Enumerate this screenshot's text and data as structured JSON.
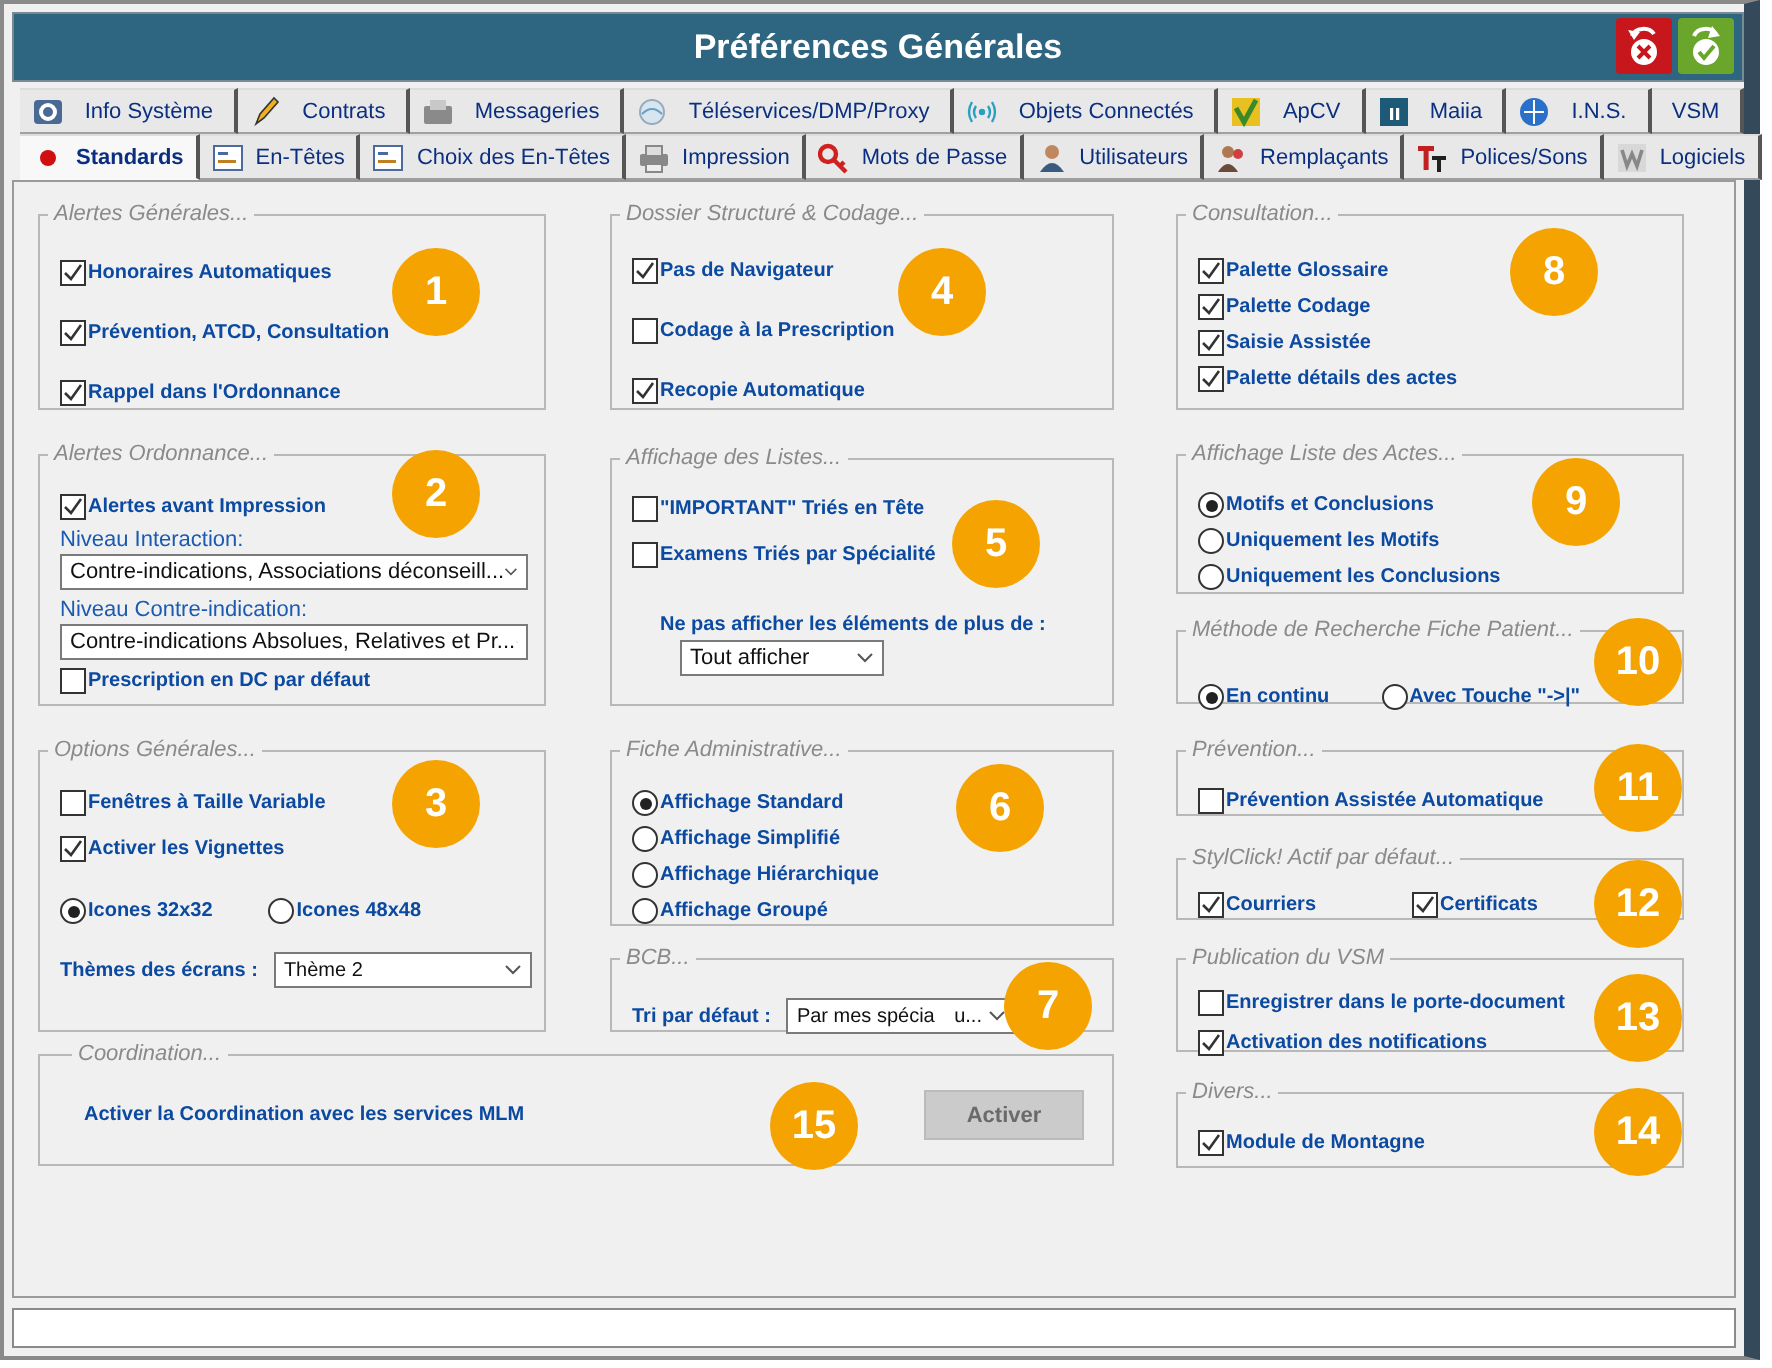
{
  "window": {
    "title": "Préférences Générales"
  },
  "tab_rows": [
    [
      {
        "label": "Info Système",
        "selected": false
      },
      {
        "label": "Contrats",
        "selected": false
      },
      {
        "label": "Messageries",
        "selected": false
      },
      {
        "label": "Téléservices/DMP/Proxy",
        "selected": false
      },
      {
        "label": "Objets Connectés",
        "selected": false
      },
      {
        "label": "ApCV",
        "selected": false
      },
      {
        "label": "Maiia",
        "selected": false
      },
      {
        "label": "I.N.S.",
        "selected": false
      },
      {
        "label": "VSM",
        "selected": false
      }
    ],
    [
      {
        "label": "Standards",
        "selected": true
      },
      {
        "label": "En-Têtes",
        "selected": false
      },
      {
        "label": "Choix des En-Têtes",
        "selected": false
      },
      {
        "label": "Impression",
        "selected": false
      },
      {
        "label": "Mots de Passe",
        "selected": false
      },
      {
        "label": "Utilisateurs",
        "selected": false
      },
      {
        "label": "Remplaçants",
        "selected": false
      },
      {
        "label": "Polices/Sons",
        "selected": false
      },
      {
        "label": "Logiciels",
        "selected": false
      }
    ]
  ],
  "columns": [
    [
      {
        "legend": "Alertes Générales...",
        "badge": "1",
        "items": [
          {
            "kind": "checkbox",
            "label": "Honoraires Automatiques",
            "checked": true
          },
          {
            "kind": "checkbox",
            "label": "Prévention, ATCD, Consultation",
            "checked": true
          },
          {
            "kind": "checkbox",
            "label": "Rappel dans l'Ordonnance",
            "checked": true
          }
        ]
      },
      {
        "legend": "Alertes Ordonnance...",
        "badge": "2",
        "items": [
          {
            "kind": "checkbox",
            "label": "Alertes avant Impression",
            "checked": true
          },
          {
            "kind": "caption",
            "text": "Niveau Interaction:"
          },
          {
            "kind": "select",
            "value": "Contre-indications, Associations déconseill..."
          },
          {
            "kind": "caption",
            "text": "Niveau Contre-indication:"
          },
          {
            "kind": "select",
            "value": "Contre-indications Absolues, Relatives et Pr..."
          },
          {
            "kind": "checkbox",
            "label": "Prescription en DC par défaut",
            "checked": false
          }
        ]
      },
      {
        "legend": "Options Générales...",
        "badge": "3",
        "items": [
          {
            "kind": "checkbox",
            "label": "Fenêtres à Taille Variable",
            "checked": false
          },
          {
            "kind": "checkbox",
            "label": "Activer les Vignettes",
            "checked": true
          },
          {
            "kind": "radio_row",
            "options": [
              {
                "label": "Icones 32x32",
                "selected": true
              },
              {
                "label": "Icones 48x48",
                "selected": false
              }
            ]
          },
          {
            "kind": "labeled_select",
            "label": "Thèmes des écrans :",
            "value": "Thème 2"
          }
        ]
      }
    ],
    [
      {
        "legend": "Dossier Structuré & Codage...",
        "badge": "4",
        "items": [
          {
            "kind": "checkbox",
            "label": "Pas de Navigateur",
            "checked": true
          },
          {
            "kind": "checkbox",
            "label": "Codage à la Prescription",
            "checked": false
          },
          {
            "kind": "checkbox",
            "label": "Recopie Automatique",
            "checked": true
          }
        ]
      },
      {
        "legend": "Affichage des Listes...",
        "badge": "5",
        "items": [
          {
            "kind": "checkbox",
            "label": "\"IMPORTANT\" Triés en Tête",
            "checked": false
          },
          {
            "kind": "checkbox",
            "label": "Examens Triés par Spécialité",
            "checked": false
          },
          {
            "kind": "wrapped_select",
            "label": "Ne pas afficher les éléments de plus de :",
            "value": "Tout afficher"
          }
        ]
      },
      {
        "legend": "Fiche Administrative...",
        "badge": "6",
        "items": [
          {
            "kind": "radio",
            "label": "Affichage Standard",
            "selected": true
          },
          {
            "kind": "radio",
            "label": "Affichage Simplifié",
            "selected": false
          },
          {
            "kind": "radio",
            "label": "Affichage Hiérarchique",
            "selected": false
          },
          {
            "kind": "radio",
            "label": "Affichage Groupé",
            "selected": false
          }
        ]
      },
      {
        "legend": "BCB...",
        "badge": "7",
        "items": [
          {
            "kind": "labeled_select",
            "label": "Tri par défaut :",
            "value": "Par mes spécia",
            "value_tail": "u..."
          }
        ]
      }
    ],
    [
      {
        "legend": "Consultation...",
        "badge": "8",
        "items": [
          {
            "kind": "checkbox",
            "label": "Palette Glossaire",
            "checked": true
          },
          {
            "kind": "checkbox",
            "label": "Palette Codage",
            "checked": true
          },
          {
            "kind": "checkbox",
            "label": "Saisie Assistée",
            "checked": true
          },
          {
            "kind": "checkbox",
            "label": "Palette détails des actes",
            "checked": true
          }
        ]
      },
      {
        "legend": "Affichage Liste des Actes...",
        "badge": "9",
        "items": [
          {
            "kind": "radio",
            "label": "Motifs et Conclusions",
            "selected": true
          },
          {
            "kind": "radio",
            "label": "Uniquement les Motifs",
            "selected": false
          },
          {
            "kind": "radio",
            "label": "Uniquement les Conclusions",
            "selected": false
          }
        ]
      },
      {
        "legend": "Méthode de Recherche Fiche Patient...",
        "badge": "10",
        "items": [
          {
            "kind": "radio_row",
            "options": [
              {
                "label": "En continu",
                "selected": true
              },
              {
                "label": "Avec Touche \"->|\"",
                "selected": false
              }
            ]
          }
        ]
      },
      {
        "legend": "Prévention...",
        "badge": "11",
        "items": [
          {
            "kind": "checkbox",
            "label": "Prévention Assistée Automatique",
            "checked": false
          }
        ]
      },
      {
        "legend": "StylClick! Actif par défaut...",
        "badge": "12",
        "items": [
          {
            "kind": "checkbox_row",
            "options": [
              {
                "label": "Courriers",
                "checked": true
              },
              {
                "label": "Certificats",
                "checked": true
              }
            ]
          }
        ]
      },
      {
        "legend": "Publication du VSM",
        "badge": "13",
        "items": [
          {
            "kind": "checkbox",
            "label": "Enregistrer dans le porte-document",
            "checked": false
          },
          {
            "kind": "checkbox",
            "label": "Activation des notifications",
            "checked": true
          }
        ]
      },
      {
        "legend": "Divers...",
        "badge": "14",
        "items": [
          {
            "kind": "checkbox",
            "label": "Module de Montagne",
            "checked": true
          }
        ]
      }
    ]
  ],
  "coordination": {
    "legend": "Coordination...",
    "badge": "15",
    "text": "Activer la Coordination avec les services MLM",
    "button": {
      "label": "Activer",
      "disabled": true
    }
  }
}
